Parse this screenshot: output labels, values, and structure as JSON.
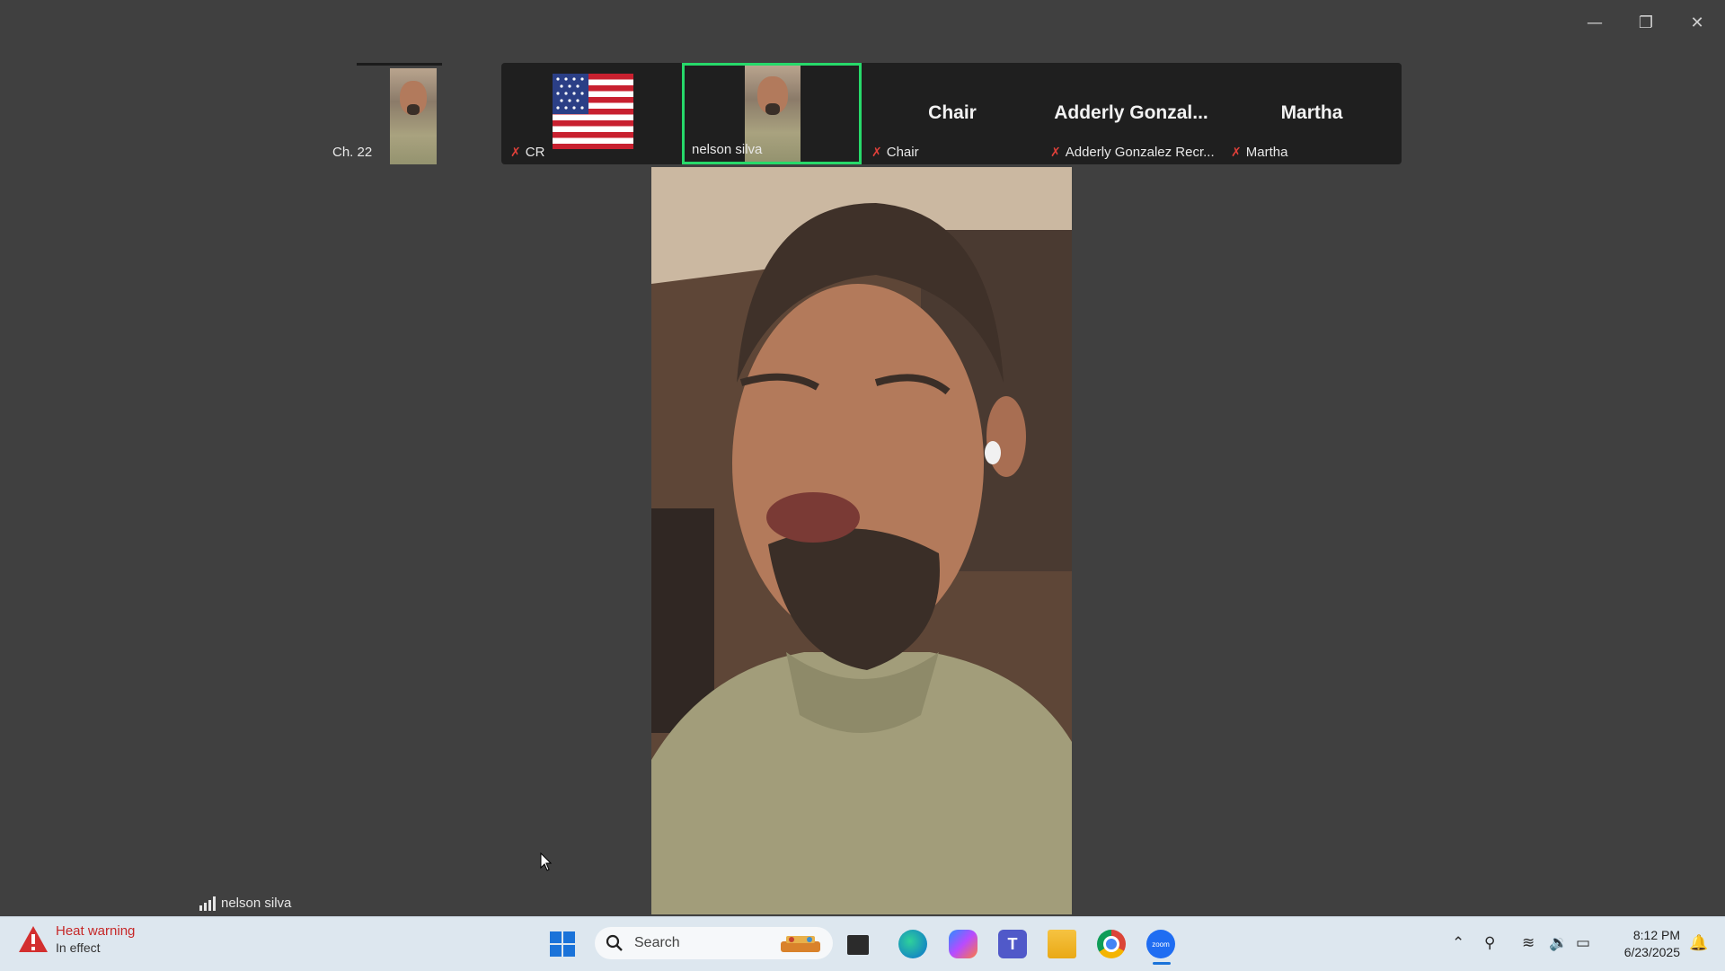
{
  "window": {
    "minimize_glyph": "—",
    "restore_glyph": "❐",
    "close_glyph": "✕"
  },
  "participants": [
    {
      "label": "Ch. 22",
      "muted": false
    },
    {
      "label": "CR",
      "muted": true
    },
    {
      "label": "nelson silva",
      "muted": false,
      "active_speaker": true
    },
    {
      "label": "Chair",
      "big_name": "Chair",
      "muted": true
    },
    {
      "label": "Adderly Gonzalez Recr...",
      "big_name": "Adderly  Gonzal...",
      "muted": true
    },
    {
      "label": "Martha",
      "big_name": "Martha",
      "muted": true
    }
  ],
  "main_speaker": {
    "name": "nelson silva"
  },
  "taskbar": {
    "weather_title": "Heat warning",
    "weather_subtitle": "In effect",
    "search_placeholder": "Search",
    "time": "8:12 PM",
    "date": "6/23/2025",
    "zoom_badge": "zoom"
  },
  "colors": {
    "active_border": "#27d96a",
    "muted_mic": "#e0403a",
    "background": "#404040"
  }
}
